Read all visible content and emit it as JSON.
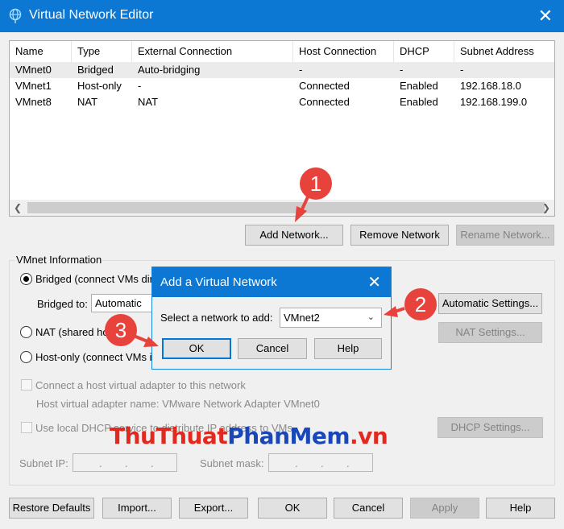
{
  "window": {
    "title": "Virtual Network Editor",
    "close_glyph": "✕"
  },
  "network_list": {
    "columns": [
      "Name",
      "Type",
      "External Connection",
      "Host Connection",
      "DHCP",
      "Subnet Address"
    ],
    "rows": [
      [
        "VMnet0",
        "Bridged",
        "Auto-bridging",
        "-",
        "-",
        "-"
      ],
      [
        "VMnet1",
        "Host-only",
        "-",
        "Connected",
        "Enabled",
        "192.168.18.0"
      ],
      [
        "VMnet8",
        "NAT",
        "NAT",
        "Connected",
        "Enabled",
        "192.168.199.0"
      ]
    ]
  },
  "network_buttons": {
    "add": "Add Network...",
    "remove": "Remove Network",
    "rename": "Rename Network..."
  },
  "vmnet_info": {
    "title": "VMnet Information",
    "bridged_label": "Bridged (connect VMs dir",
    "bridged_to_label": "Bridged to:",
    "bridged_to_value": "Automatic",
    "automatic_settings": "Automatic Settings...",
    "nat_label": "NAT (shared ho",
    "nat_settings": "NAT Settings...",
    "hostonly_label": "Host-only (connect VMs i",
    "connect_adapter_label": "Connect a host virtual adapter to this network",
    "adapter_name_label": "Host virtual adapter name: VMware Network Adapter VMnet0",
    "dhcp_label": "Use local DHCP service to distribute IP address to VMs",
    "dhcp_settings": "DHCP Settings...",
    "subnet_ip_label": "Subnet IP:",
    "subnet_mask_label": "Subnet mask:"
  },
  "footer_buttons": {
    "restore": "Restore Defaults",
    "import": "Import...",
    "export": "Export...",
    "ok": "OK",
    "cancel": "Cancel",
    "apply": "Apply",
    "help": "Help"
  },
  "dialog": {
    "title": "Add a Virtual Network",
    "close_glyph": "✕",
    "prompt": "Select a network to add:",
    "selected": "VMnet2",
    "ok": "OK",
    "cancel": "Cancel",
    "help": "Help"
  },
  "annotations": [
    "1",
    "2",
    "3"
  ],
  "watermark": {
    "part1": "ThuThuat",
    "part2": "PhanMem",
    "part3": ".vn"
  },
  "colors": {
    "accent": "#0c78d4",
    "marker": "#e8423c"
  }
}
